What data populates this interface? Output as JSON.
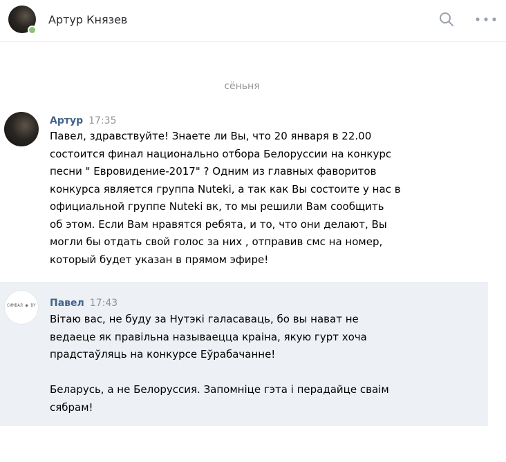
{
  "header": {
    "name": "Артур Князев",
    "online": true
  },
  "divider": {
    "label": "сёньня"
  },
  "messages": [
    {
      "author": "Артур",
      "time": "17:35",
      "lines": [
        "Павел, здравствуйте! Знаете ли Вы, что 20 января в 22.00",
        "состоится финал национально отбора Белоруссии на конкурс",
        "песни \" Евровидение-2017\" ? Одним из главных фаворитов",
        "конкурса является группа Nuteki, а так как Вы состоите у нас в",
        "официальной группе Nuteki вк, то мы решили Вам сообщить",
        "об этом. Если Вам нравятся ребята, и то, что они делают, Вы",
        "могли бы отдать свой голос за них , отправив смс на номер,",
        "который будет указан в прямом эфире!"
      ]
    },
    {
      "author": "Павел",
      "time": "17:43",
      "avatar_text": "СИМВАЛ ● BY",
      "lines": [
        "Вітаю вас, не буду за Нутэкі галасаваць, бо вы нават не",
        "ведаеце як правільна называецца краіна, якую гурт хоча",
        "прадстаўляць на конкурсе Еўрабачанне!",
        "",
        "Беларусь, а не Белоруссия. Запомніце гэта і перадайце сваім",
        "сябрам!"
      ]
    }
  ],
  "colors": {
    "author": "#42648b",
    "muted": "#939393",
    "highlight_bg": "#edf0f5",
    "icon": "#99a2ad",
    "online": "#8ac176"
  },
  "icons": {
    "search": "search-icon",
    "more": "more-dots-icon"
  }
}
